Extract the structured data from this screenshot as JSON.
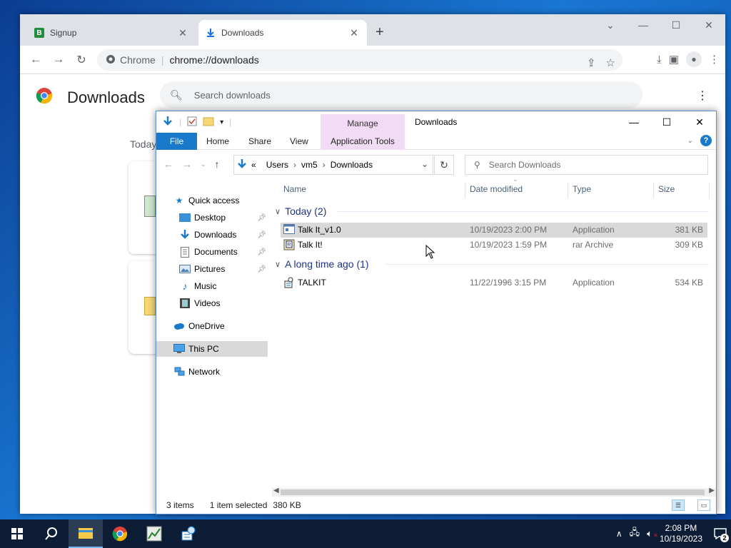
{
  "chrome": {
    "tabs": [
      {
        "label": "Signup",
        "favicon": "B"
      },
      {
        "label": "Downloads"
      }
    ],
    "omnibox": {
      "site": "Chrome",
      "url": "chrome://downloads"
    },
    "page": {
      "title": "Downloads",
      "search_placeholder": "Search downloads",
      "section": "Today"
    }
  },
  "explorer": {
    "title": "Downloads",
    "manage_label": "Manage",
    "ribbon_tabs": [
      "File",
      "Home",
      "Share",
      "View",
      "Application Tools"
    ],
    "breadcrumb": {
      "prefix": "«",
      "parts": [
        "Users",
        "vm5",
        "Downloads"
      ]
    },
    "search_placeholder": "Search Downloads",
    "nav": {
      "quick_access": "Quick access",
      "desktop": "Desktop",
      "downloads": "Downloads",
      "documents": "Documents",
      "pictures": "Pictures",
      "music": "Music",
      "videos": "Videos",
      "onedrive": "OneDrive",
      "this_pc": "This PC",
      "network": "Network"
    },
    "columns": {
      "name": "Name",
      "date": "Date modified",
      "type": "Type",
      "size": "Size"
    },
    "groups": [
      {
        "label": "Today (2)",
        "files": [
          {
            "name": "Talk It_v1.0",
            "date": "10/19/2023 2:00 PM",
            "type": "Application",
            "size": "381 KB"
          },
          {
            "name": "Talk It!",
            "date": "10/19/2023 1:59 PM",
            "type": "rar Archive",
            "size": "309 KB"
          }
        ]
      },
      {
        "label": "A long time ago (1)",
        "files": [
          {
            "name": "TALKIT",
            "date": "11/22/1996 3:15 PM",
            "type": "Application",
            "size": "534 KB"
          }
        ]
      }
    ],
    "status": {
      "items": "3 items",
      "selected": "1 item selected",
      "size": "380 KB"
    }
  },
  "taskbar": {
    "time": "2:08 PM",
    "date": "10/19/2023",
    "notifications": "2"
  },
  "colors": {
    "accent": "#1979ca",
    "manage_tab": "#f2dcf5",
    "taskbar": "#0c1d35",
    "selection": "#d9d9d9"
  }
}
